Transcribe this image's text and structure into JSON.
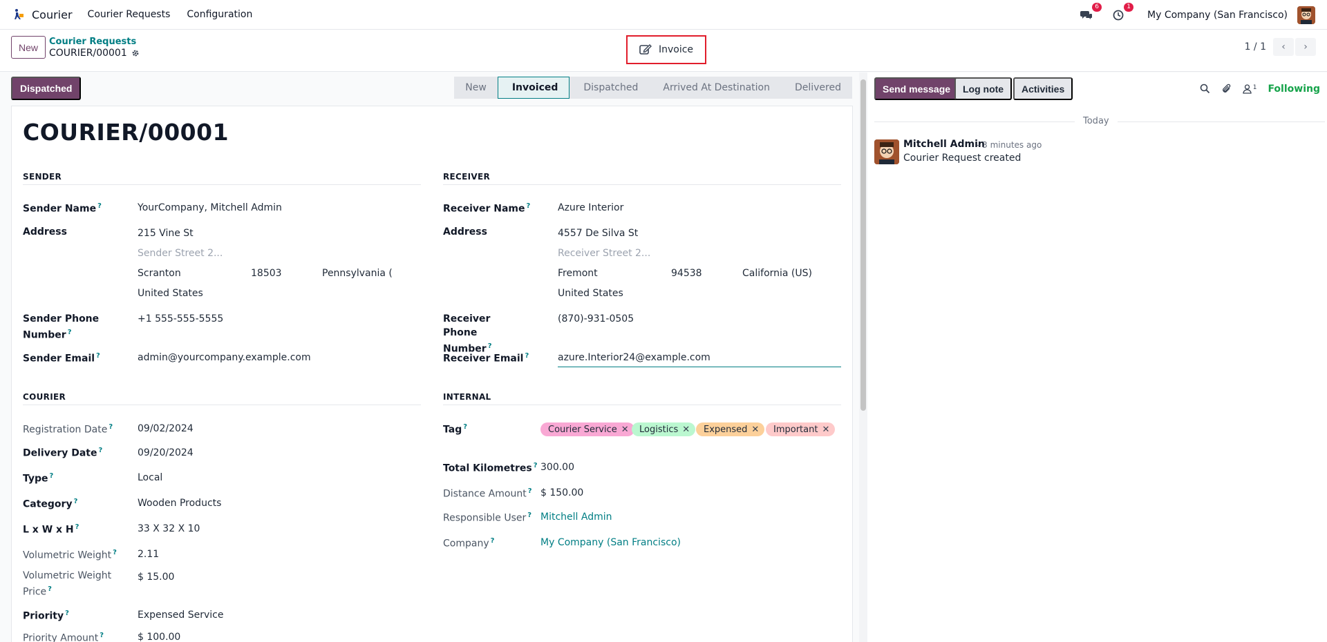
{
  "navbar": {
    "app_name": "Courier",
    "menu": [
      "Courier Requests",
      "Configuration"
    ],
    "messages_count": "6",
    "activities_count": "1",
    "company": "My Company (San Francisco)"
  },
  "control": {
    "new_label": "New",
    "breadcrumb_parent": "Courier Requests",
    "breadcrumb_current": "COURIER/00001",
    "invoice_label": "Invoice",
    "pager": "1 / 1"
  },
  "statusbar": {
    "dispatched_button": "Dispatched",
    "stages": [
      "New",
      "Invoiced",
      "Dispatched",
      "Arrived At Destination",
      "Delivered"
    ],
    "active_stage": "Invoiced"
  },
  "form": {
    "title": "COURIER/00001",
    "sender": {
      "heading": "SENDER",
      "name_label": "Sender Name",
      "name": "YourCompany, Mitchell Admin",
      "address_label": "Address",
      "street": "215 Vine St",
      "street2_placeholder": "Sender Street 2...",
      "city": "Scranton",
      "zip": "18503",
      "state": "Pennsylvania (",
      "country": "United States",
      "phone_label": "Sender Phone Number",
      "phone": "+1 555-555-5555",
      "email_label": "Sender Email",
      "email": "admin@yourcompany.example.com"
    },
    "receiver": {
      "heading": "RECEIVER",
      "name_label": "Receiver Name",
      "name": "Azure Interior",
      "address_label": "Address",
      "street": "4557 De Silva St",
      "street2_placeholder": "Receiver Street 2...",
      "city": "Fremont",
      "zip": "94538",
      "state": "California (US)",
      "country": "United States",
      "phone_label": "Receiver Phone Number",
      "phone": "(870)-931-0505",
      "email_label": "Receiver Email",
      "email": "azure.Interior24@example.com"
    },
    "courier": {
      "heading": "COURIER",
      "registration_date_label": "Registration Date",
      "registration_date": "09/02/2024",
      "delivery_date_label": "Delivery Date",
      "delivery_date": "09/20/2024",
      "type_label": "Type",
      "type": "Local",
      "category_label": "Category",
      "category": "Wooden Products",
      "lwh_label": "L x W x H",
      "lwh": "33 X 32 X 10",
      "vol_weight_label": "Volumetric Weight",
      "vol_weight": "2.11",
      "vol_price_label": "Volumetric Weight Price",
      "vol_price": "$ 15.00",
      "priority_label": "Priority",
      "priority": "Expensed Service",
      "priority_amount_label": "Priority Amount",
      "priority_amount": "$ 100.00"
    },
    "internal": {
      "heading": "INTERNAL",
      "tag_label": "Tag",
      "tags": [
        {
          "label": "Courier Service",
          "color": "#f9a8d4"
        },
        {
          "label": "Logistics",
          "color": "#bbf7d0"
        },
        {
          "label": "Expensed",
          "color": "#fcd09a"
        },
        {
          "label": "Important",
          "color": "#fecaca"
        }
      ],
      "km_label": "Total Kilometres",
      "km": "300.00",
      "distance_amount_label": "Distance Amount",
      "distance_amount": "$ 150.00",
      "responsible_label": "Responsible User",
      "responsible": "Mitchell Admin",
      "company_label": "Company",
      "company": "My Company (San Francisco)"
    }
  },
  "chatter": {
    "send_message": "Send message",
    "log_note": "Log note",
    "activities": "Activities",
    "followers_count": "1",
    "following": "Following",
    "today": "Today",
    "message": {
      "author": "Mitchell Admin",
      "time": "- 3 minutes ago",
      "body": "Courier Request created"
    }
  }
}
